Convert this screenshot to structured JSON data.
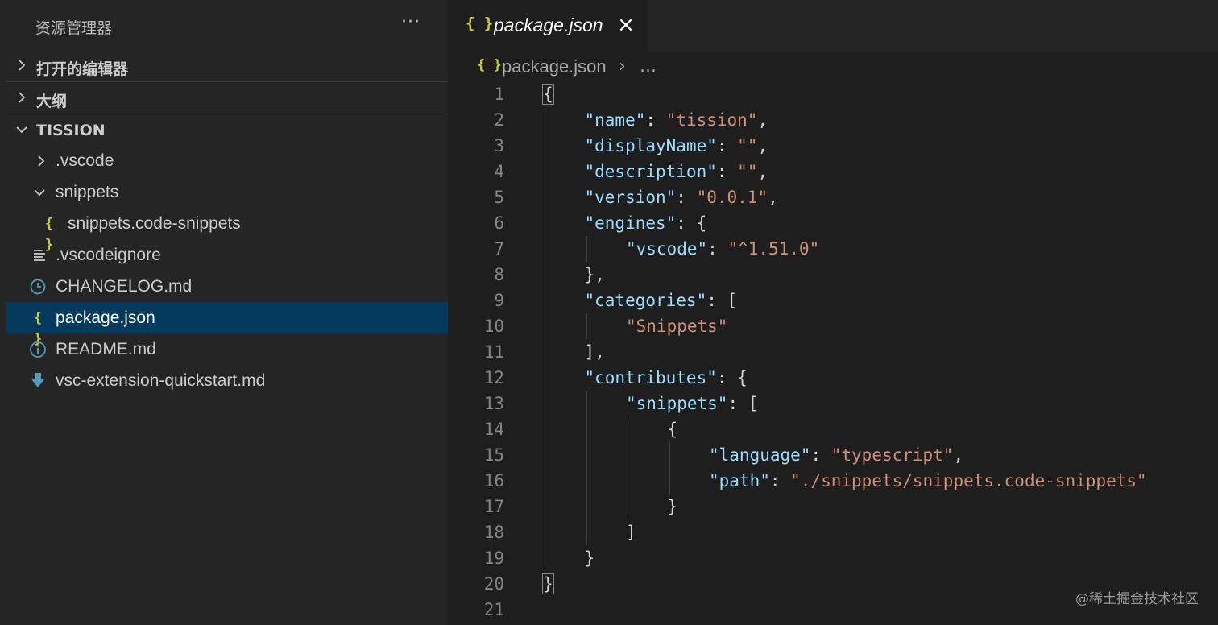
{
  "sidebar": {
    "title": "资源管理器",
    "more_label": "···",
    "sections": {
      "open_editors": "打开的编辑器",
      "outline": "大纲",
      "project": "TISSION"
    },
    "tree": [
      {
        "label": ".vscode",
        "icon": "chevron-right-icon"
      },
      {
        "label": "snippets",
        "icon": "chevron-down-icon"
      },
      {
        "label": "snippets.code-snippets",
        "icon": "json-braces-icon",
        "icon_text": "{ }"
      },
      {
        "label": ".vscodeignore",
        "icon": "lines-icon"
      },
      {
        "label": "CHANGELOG.md",
        "icon": "clock-icon"
      },
      {
        "label": "package.json",
        "icon": "json-braces-icon",
        "icon_text": "{ }",
        "selected": true
      },
      {
        "label": "README.md",
        "icon": "info-icon",
        "icon_text": "i"
      },
      {
        "label": "vsc-extension-quickstart.md",
        "icon": "download-arrow-icon"
      }
    ]
  },
  "editor": {
    "tab": {
      "icon_text": "{ }",
      "label": "package.json",
      "close": "×"
    },
    "breadcrumb": {
      "icon_text": "{ }",
      "file": "package.json",
      "separator": "›",
      "more": "..."
    },
    "lines": [
      {
        "n": "1",
        "indent": 0,
        "tokens": [
          {
            "t": "{",
            "c": "pun",
            "match": true
          }
        ]
      },
      {
        "n": "2",
        "indent": 1,
        "tokens": [
          {
            "t": "\"name\"",
            "c": "key"
          },
          {
            "t": ": ",
            "c": "pun"
          },
          {
            "t": "\"tission\"",
            "c": "str"
          },
          {
            "t": ",",
            "c": "pun"
          }
        ]
      },
      {
        "n": "3",
        "indent": 1,
        "tokens": [
          {
            "t": "\"displayName\"",
            "c": "key"
          },
          {
            "t": ": ",
            "c": "pun"
          },
          {
            "t": "\"\"",
            "c": "str"
          },
          {
            "t": ",",
            "c": "pun"
          }
        ]
      },
      {
        "n": "4",
        "indent": 1,
        "tokens": [
          {
            "t": "\"description\"",
            "c": "key"
          },
          {
            "t": ": ",
            "c": "pun"
          },
          {
            "t": "\"\"",
            "c": "str"
          },
          {
            "t": ",",
            "c": "pun"
          }
        ]
      },
      {
        "n": "5",
        "indent": 1,
        "tokens": [
          {
            "t": "\"version\"",
            "c": "key"
          },
          {
            "t": ": ",
            "c": "pun"
          },
          {
            "t": "\"0.0.1\"",
            "c": "str"
          },
          {
            "t": ",",
            "c": "pun"
          }
        ]
      },
      {
        "n": "6",
        "indent": 1,
        "tokens": [
          {
            "t": "\"engines\"",
            "c": "key"
          },
          {
            "t": ": {",
            "c": "pun"
          }
        ]
      },
      {
        "n": "7",
        "indent": 2,
        "tokens": [
          {
            "t": "\"vscode\"",
            "c": "key"
          },
          {
            "t": ": ",
            "c": "pun"
          },
          {
            "t": "\"^1.51.0\"",
            "c": "str"
          }
        ]
      },
      {
        "n": "8",
        "indent": 1,
        "tokens": [
          {
            "t": "},",
            "c": "pun"
          }
        ]
      },
      {
        "n": "9",
        "indent": 1,
        "tokens": [
          {
            "t": "\"categories\"",
            "c": "key"
          },
          {
            "t": ": [",
            "c": "pun"
          }
        ]
      },
      {
        "n": "10",
        "indent": 2,
        "tokens": [
          {
            "t": "\"Snippets\"",
            "c": "str"
          }
        ]
      },
      {
        "n": "11",
        "indent": 1,
        "tokens": [
          {
            "t": "],",
            "c": "pun"
          }
        ]
      },
      {
        "n": "12",
        "indent": 1,
        "tokens": [
          {
            "t": "\"contributes\"",
            "c": "key"
          },
          {
            "t": ": {",
            "c": "pun"
          }
        ]
      },
      {
        "n": "13",
        "indent": 2,
        "tokens": [
          {
            "t": "\"snippets\"",
            "c": "key"
          },
          {
            "t": ": [",
            "c": "pun"
          }
        ]
      },
      {
        "n": "14",
        "indent": 3,
        "tokens": [
          {
            "t": "{",
            "c": "pun"
          }
        ]
      },
      {
        "n": "15",
        "indent": 4,
        "tokens": [
          {
            "t": "\"language\"",
            "c": "key"
          },
          {
            "t": ": ",
            "c": "pun"
          },
          {
            "t": "\"typescript\"",
            "c": "str"
          },
          {
            "t": ",",
            "c": "pun"
          }
        ]
      },
      {
        "n": "16",
        "indent": 4,
        "tokens": [
          {
            "t": "\"path\"",
            "c": "key"
          },
          {
            "t": ": ",
            "c": "pun"
          },
          {
            "t": "\"./snippets/snippets.code-snippets\"",
            "c": "str"
          }
        ]
      },
      {
        "n": "17",
        "indent": 3,
        "tokens": [
          {
            "t": "}",
            "c": "pun"
          }
        ]
      },
      {
        "n": "18",
        "indent": 2,
        "tokens": [
          {
            "t": "]",
            "c": "pun"
          }
        ]
      },
      {
        "n": "19",
        "indent": 1,
        "tokens": [
          {
            "t": "}",
            "c": "pun"
          }
        ]
      },
      {
        "n": "20",
        "indent": 0,
        "tokens": [
          {
            "t": "}",
            "c": "pun",
            "match": true
          }
        ]
      },
      {
        "n": "21",
        "indent": 0,
        "tokens": []
      }
    ]
  },
  "watermark": "@稀土掘金技术社区",
  "colors": {
    "sidebar_bg": "#252526",
    "editor_bg": "#1e1e1e",
    "selection": "#04395e",
    "json_icon": "#cbcb41",
    "md_icon": "#519aba",
    "key": "#9cdcfe",
    "string": "#ce9178"
  }
}
